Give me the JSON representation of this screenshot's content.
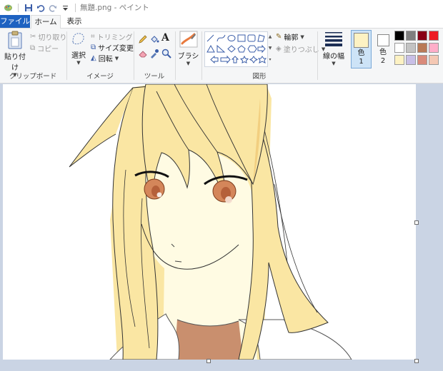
{
  "window": {
    "title": "無題.png - ペイント"
  },
  "tabs": {
    "file": "ファイル",
    "home": "ホーム",
    "view": "表示"
  },
  "ribbon": {
    "clipboard": {
      "paste": "貼り付け",
      "cut": "切り取り",
      "copy": "コピー",
      "group": "クリップボード"
    },
    "image": {
      "select": "選択",
      "crop": "トリミング",
      "resize": "サイズ変更",
      "rotate": "回転",
      "group": "イメージ"
    },
    "tools": {
      "group": "ツール"
    },
    "brushes": {
      "label": "ブラシ"
    },
    "shapes": {
      "outline": "輪郭",
      "fill": "塗りつぶし",
      "group": "図形"
    },
    "size": {
      "label": "線の幅"
    },
    "colors": {
      "color1": "色",
      "color1_num": "1",
      "color2": "色",
      "color2_num": "2",
      "color1_value": "#fdf2c3",
      "color2_value": "#ffffff",
      "palette": [
        "#000000",
        "#7f7f7f",
        "#880015",
        "#ed1c24",
        "#ffffff",
        "#c3c3c3",
        "#b97a57",
        "#ffaec9",
        "#fdf2c3",
        "#c8bfe7",
        "#d98a7a",
        "#f4c8b4"
      ]
    }
  },
  "colors": {
    "accent": "#1e62c1",
    "ribbon_bg": "#f5f6f7",
    "workspace_bg": "#cad4e4",
    "hair": "#fae6a3",
    "hair_shadow": "#f2cf80",
    "skin": "#fffbe3",
    "eye": "#d4865a",
    "shirt_inner": "#c98f6e"
  }
}
